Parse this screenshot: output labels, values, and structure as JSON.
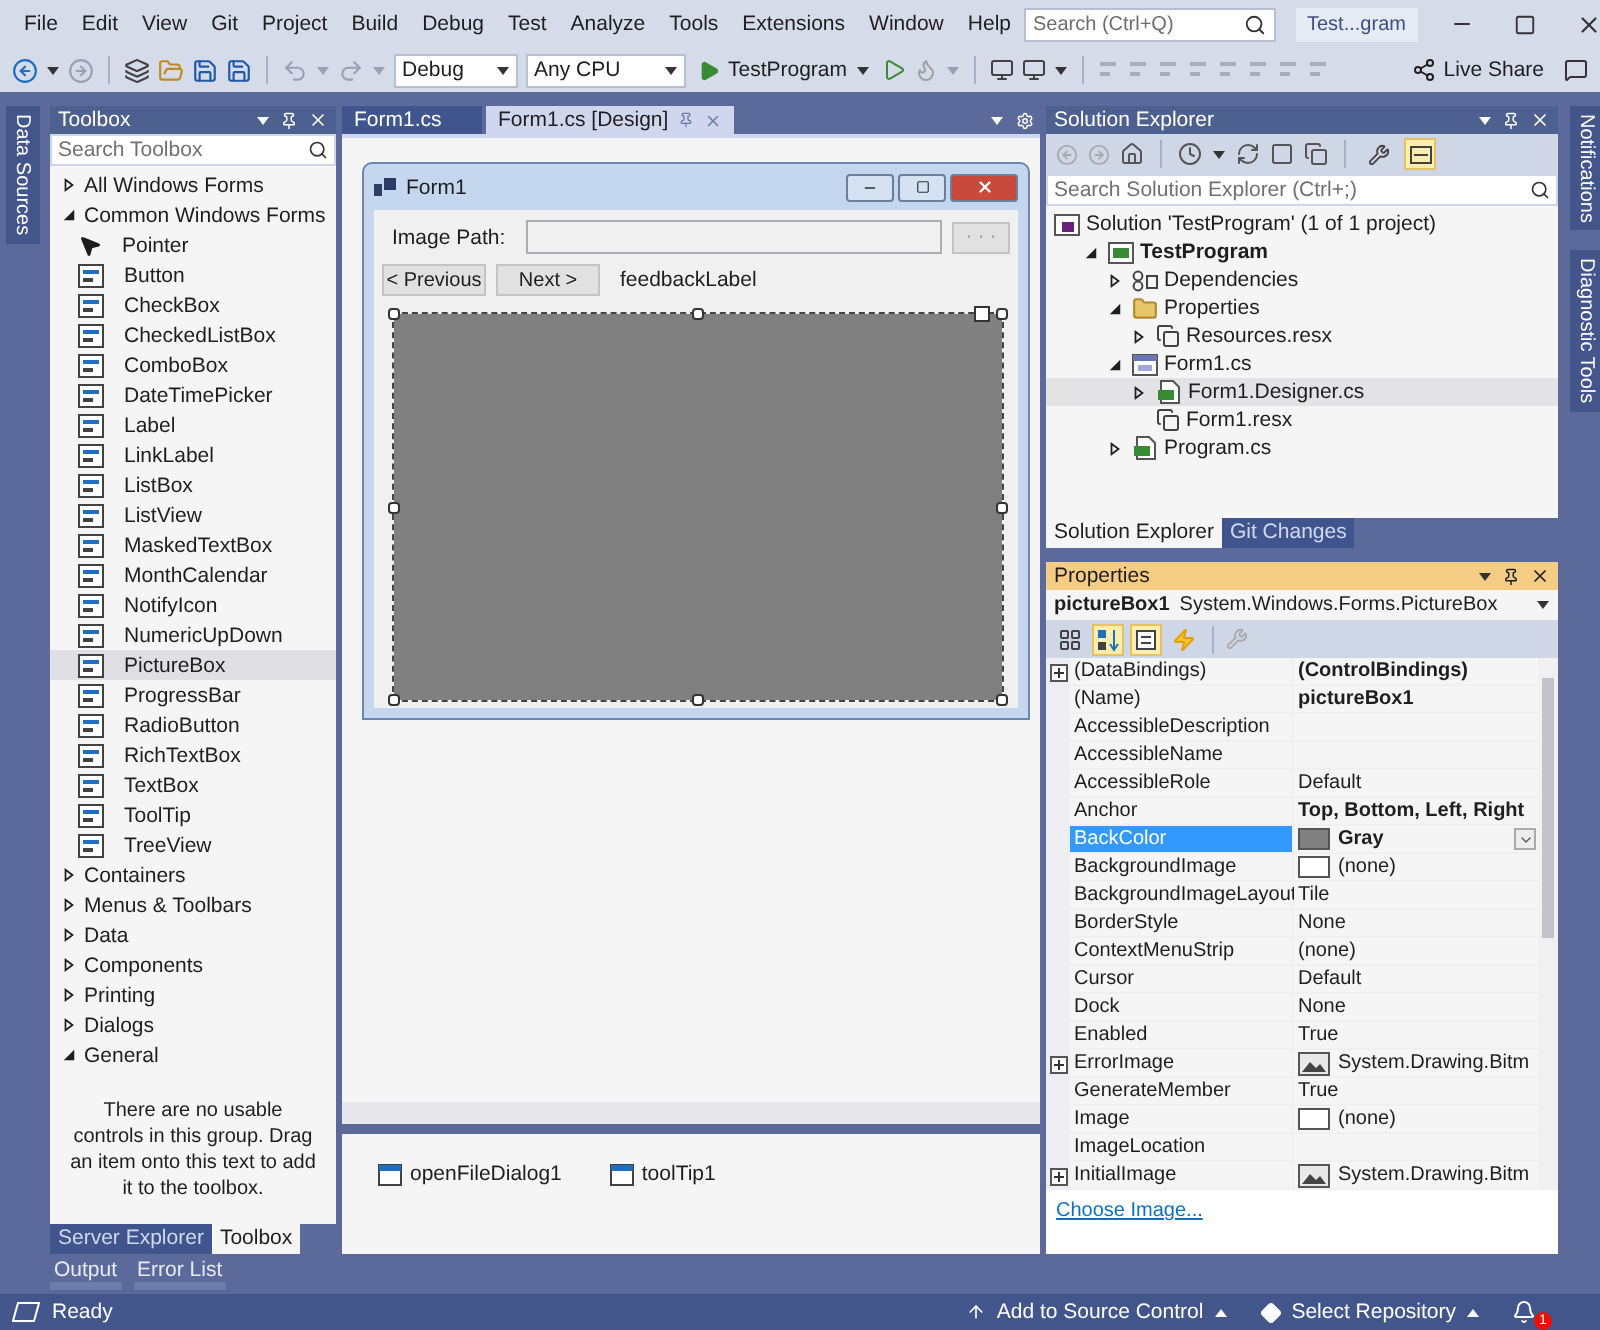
{
  "menu": [
    "File",
    "Edit",
    "View",
    "Git",
    "Project",
    "Build",
    "Debug",
    "Test",
    "Analyze",
    "Tools",
    "Extensions",
    "Window",
    "Help"
  ],
  "search": {
    "placeholder": "Search (Ctrl+Q)"
  },
  "window_title": "Test...gram",
  "toolbar": {
    "configuration": "Debug",
    "platform": "Any CPU",
    "run_target": "TestProgram",
    "live_share": "Live Share"
  },
  "left_strip": [
    "Data Sources"
  ],
  "toolbox": {
    "title": "Toolbox",
    "search": {
      "placeholder": "Search Toolbox"
    },
    "groups": [
      {
        "label": "All Windows Forms",
        "expanded": false
      },
      {
        "label": "Common Windows Forms",
        "expanded": true,
        "items": [
          {
            "label": "Pointer",
            "selected": false
          },
          {
            "label": "Button",
            "selected": false
          },
          {
            "label": "CheckBox",
            "selected": false
          },
          {
            "label": "CheckedListBox",
            "selected": false
          },
          {
            "label": "ComboBox",
            "selected": false
          },
          {
            "label": "DateTimePicker",
            "selected": false
          },
          {
            "label": "Label",
            "selected": false
          },
          {
            "label": "LinkLabel",
            "selected": false
          },
          {
            "label": "ListBox",
            "selected": false
          },
          {
            "label": "ListView",
            "selected": false
          },
          {
            "label": "MaskedTextBox",
            "selected": false
          },
          {
            "label": "MonthCalendar",
            "selected": false
          },
          {
            "label": "NotifyIcon",
            "selected": false
          },
          {
            "label": "NumericUpDown",
            "selected": false
          },
          {
            "label": "PictureBox",
            "selected": true
          },
          {
            "label": "ProgressBar",
            "selected": false
          },
          {
            "label": "RadioButton",
            "selected": false
          },
          {
            "label": "RichTextBox",
            "selected": false
          },
          {
            "label": "TextBox",
            "selected": false
          },
          {
            "label": "ToolTip",
            "selected": false
          },
          {
            "label": "TreeView",
            "selected": false
          }
        ]
      },
      {
        "label": "Containers",
        "expanded": false
      },
      {
        "label": "Menus & Toolbars",
        "expanded": false
      },
      {
        "label": "Data",
        "expanded": false
      },
      {
        "label": "Components",
        "expanded": false
      },
      {
        "label": "Printing",
        "expanded": false
      },
      {
        "label": "Dialogs",
        "expanded": false
      },
      {
        "label": "General",
        "expanded": true,
        "empty_text": "There are no usable controls in this group. Drag an item onto this text to add it to the toolbox."
      }
    ],
    "tabs": [
      {
        "label": "Server Explorer",
        "selected": false
      },
      {
        "label": "Toolbox",
        "selected": true
      }
    ]
  },
  "editor": {
    "tabs": [
      {
        "label": "Form1.cs",
        "selected": false
      },
      {
        "label": "Form1.cs [Design]",
        "selected": true
      }
    ],
    "form": {
      "title": "Form1",
      "path_label": "Image Path:",
      "browse_button": "· · ·",
      "buttons": [
        "< Previous",
        "Next >"
      ],
      "feedback_label": "feedbackLabel",
      "picture_box": {
        "selected": true
      }
    },
    "tray": [
      "openFileDialog1",
      "toolTip1"
    ]
  },
  "solution_explorer": {
    "title": "Solution Explorer",
    "toggles": [
      {
        "kind": "properties",
        "selected": false
      },
      {
        "kind": "preview",
        "selected": true
      }
    ],
    "search": {
      "placeholder": "Search Solution Explorer (Ctrl+;)"
    },
    "tree": [
      {
        "label": "Solution 'TestProgram' (1 of 1 project)",
        "kind": "solution",
        "selected": false,
        "bold": false,
        "children": [
          {
            "label": "TestProgram",
            "kind": "project",
            "selected": false,
            "bold": true,
            "expanded": true,
            "children": [
              {
                "label": "Dependencies",
                "kind": "dependencies",
                "selected": false,
                "bold": false,
                "expanded": false
              },
              {
                "label": "Properties",
                "kind": "folder",
                "selected": false,
                "bold": false,
                "expanded": true,
                "children": [
                  {
                    "label": "Resources.resx",
                    "kind": "resource",
                    "selected": false,
                    "bold": false,
                    "expanded": false
                  }
                ]
              },
              {
                "label": "Form1.cs",
                "kind": "form",
                "selected": false,
                "bold": false,
                "expanded": true,
                "children": [
                  {
                    "label": "Form1.Designer.cs",
                    "kind": "code",
                    "selected": true,
                    "bold": false,
                    "expanded": false
                  },
                  {
                    "label": "Form1.resx",
                    "kind": "resource",
                    "selected": false,
                    "bold": false
                  }
                ]
              },
              {
                "label": "Program.cs",
                "kind": "code",
                "selected": false,
                "bold": false,
                "expanded": false
              }
            ]
          }
        ]
      }
    ],
    "tabs": [
      {
        "label": "Solution Explorer",
        "selected": true
      },
      {
        "label": "Git Changes",
        "selected": false
      }
    ]
  },
  "properties": {
    "title": "Properties",
    "object_name": "pictureBox1",
    "object_type": "System.Windows.Forms.PictureBox",
    "toolbar": [
      {
        "kind": "categorized",
        "selected": false
      },
      {
        "kind": "alphabetical",
        "selected": true
      },
      {
        "kind": "properties",
        "selected": true
      },
      {
        "kind": "events",
        "selected": false
      }
    ],
    "rows": [
      {
        "name": "(DataBindings)",
        "value": "(ControlBindings)",
        "bold": true,
        "expandable": true,
        "selected": false
      },
      {
        "name": "(Name)",
        "value": "pictureBox1",
        "bold": true,
        "expandable": false,
        "selected": false
      },
      {
        "name": "AccessibleDescription",
        "bold": false,
        "expandable": false,
        "selected": false
      },
      {
        "name": "AccessibleName",
        "bold": false,
        "expandable": false,
        "selected": false
      },
      {
        "name": "AccessibleRole",
        "value": "Default",
        "bold": false,
        "expandable": false,
        "selected": false
      },
      {
        "name": "Anchor",
        "value": "Top, Bottom, Left, Right",
        "bold": true,
        "expandable": false,
        "selected": false
      },
      {
        "name": "BackColor",
        "value": "Gray",
        "bold": true,
        "expandable": false,
        "selected": true,
        "dropdown": true,
        "preview": {
          "kind": "color",
          "color": "#808080"
        }
      },
      {
        "name": "BackgroundImage",
        "value": "(none)",
        "bold": false,
        "expandable": false,
        "selected": false,
        "preview": {
          "kind": "empty"
        }
      },
      {
        "name": "BackgroundImageLayout",
        "value": "Tile",
        "bold": false,
        "expandable": false,
        "selected": false
      },
      {
        "name": "BorderStyle",
        "value": "None",
        "bold": false,
        "expandable": false,
        "selected": false
      },
      {
        "name": "ContextMenuStrip",
        "value": "(none)",
        "bold": false,
        "expandable": false,
        "selected": false
      },
      {
        "name": "Cursor",
        "value": "Default",
        "bold": false,
        "expandable": false,
        "selected": false
      },
      {
        "name": "Dock",
        "value": "None",
        "bold": false,
        "expandable": false,
        "selected": false
      },
      {
        "name": "Enabled",
        "value": "True",
        "bold": false,
        "expandable": false,
        "selected": false
      },
      {
        "name": "ErrorImage",
        "value": "System.Drawing.Bitm",
        "bold": false,
        "expandable": true,
        "selected": false,
        "preview": {
          "kind": "image"
        }
      },
      {
        "name": "GenerateMember",
        "value": "True",
        "bold": false,
        "expandable": false,
        "selected": false
      },
      {
        "name": "Image",
        "value": "(none)",
        "bold": false,
        "expandable": false,
        "selected": false,
        "preview": {
          "kind": "empty"
        }
      },
      {
        "name": "ImageLocation",
        "bold": false,
        "expandable": false,
        "selected": false
      },
      {
        "name": "InitialImage",
        "value": "System.Drawing.Bitm",
        "bold": false,
        "expandable": true,
        "selected": false,
        "preview": {
          "kind": "image"
        }
      }
    ],
    "link": "Choose Image..."
  },
  "output_tabs": [
    "Output",
    "Error List"
  ],
  "right_strip": [
    "Notifications",
    "Diagnostic Tools"
  ],
  "status_bar": {
    "text": "Ready",
    "source_control": "Add to Source Control",
    "repository": "Select Repository",
    "notifications": "1"
  }
}
